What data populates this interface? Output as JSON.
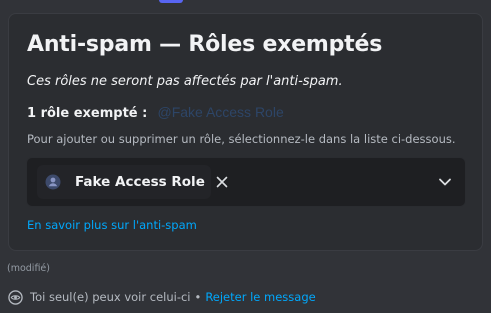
{
  "embed": {
    "title": "Anti-spam — Rôles exemptés",
    "subtitle": "Ces rôles ne seront pas affectés par l'anti-spam.",
    "count_label": "1 rôle exempté :",
    "mention_text": "@Fake Access Role",
    "hint": "Pour ajouter ou supprimer un rôle, sélectionnez-le dans la liste ci-dessous.",
    "learn_more_link": "En savoir plus sur l'anti-spam"
  },
  "role_select": {
    "selected_role": "Fake Access Role",
    "role_icon": "role-shield-icon",
    "remove_icon": "close-icon",
    "dropdown_icon": "chevron-down-icon"
  },
  "message": {
    "edited_label": "(modifié)",
    "ephemeral_notice": "Toi seul(e) peux voir celui-ci",
    "separator": "•",
    "dismiss_link": "Rejeter le message"
  },
  "colors": {
    "background": "#313338",
    "panel": "#2b2d31",
    "select_bg": "#1e1f22",
    "link": "#00a8fc",
    "accent": "#5865f2"
  }
}
